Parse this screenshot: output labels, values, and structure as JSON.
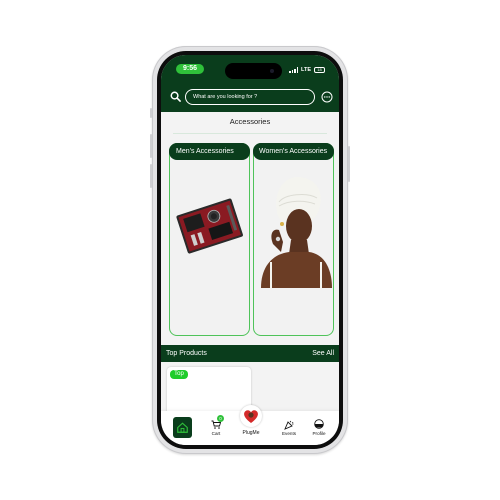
{
  "status_bar": {
    "time": "9:56",
    "network": "LTE",
    "battery": "18"
  },
  "search": {
    "placeholder": "What are you looking for ?"
  },
  "section_title": "Accessories",
  "categories": [
    {
      "label": "Men's Accessories"
    },
    {
      "label": "Women's Accessories"
    }
  ],
  "top_products": {
    "title": "Top Products",
    "see_all": "See All",
    "badge": "Top"
  },
  "nav": {
    "cart": {
      "label": "Cart",
      "badge": "0"
    },
    "plugme": {
      "label": "PlugMe"
    },
    "events": {
      "label": "Events"
    },
    "profile": {
      "label": "Profile"
    }
  },
  "colors": {
    "brand": "#0a3d1c",
    "accent": "#2fc13a",
    "card_border": "#4fc35a"
  }
}
